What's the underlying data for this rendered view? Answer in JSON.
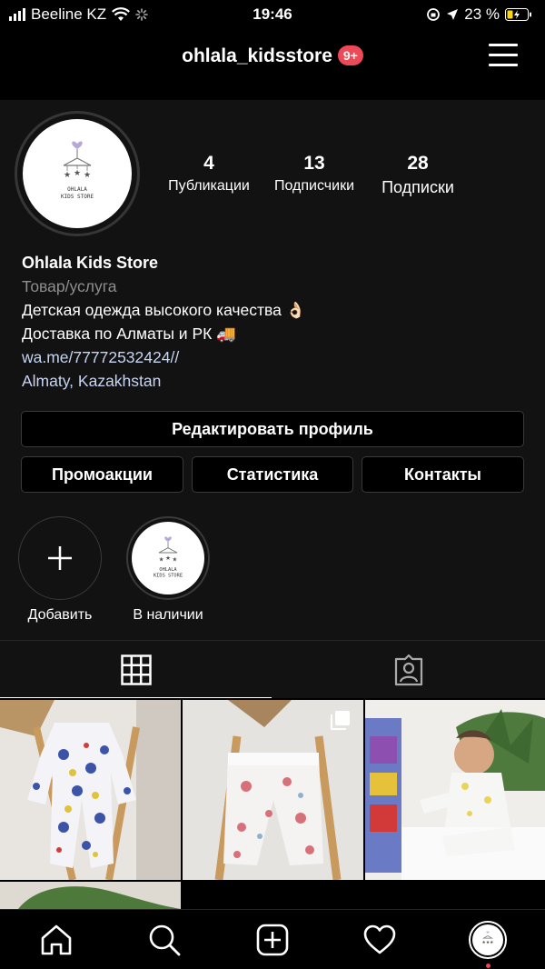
{
  "status_bar": {
    "carrier": "Beeline KZ",
    "time": "19:46",
    "battery": "23 %"
  },
  "header": {
    "username": "ohlala_kidsstore",
    "notification_badge": "9+"
  },
  "profile": {
    "avatar_logo": {
      "line1": "OHLALA",
      "line2": "KIDS STORE"
    },
    "stats": [
      {
        "value": "4",
        "label": "Публикации"
      },
      {
        "value": "13",
        "label": "Подписчики"
      },
      {
        "value": "28",
        "label": "Подписки"
      }
    ],
    "name": "Ohlala Kids Store",
    "category": "Товар/услуга",
    "bio_line1": "Детская одежда высокого качества 👌🏻",
    "bio_line2": "Доставка по Алматы и РК 🚚",
    "link": "wa.me/77772532424//",
    "location": "Almaty, Kazakhstan"
  },
  "buttons": {
    "edit_profile": "Редактировать профиль",
    "promotions": "Промоакции",
    "statistics": "Статистика",
    "contacts": "Контакты"
  },
  "highlights": [
    {
      "label": "Добавить",
      "icon": "plus-icon"
    },
    {
      "label": "В наличии",
      "icon": "store-logo"
    }
  ],
  "tabs": [
    {
      "name": "grid",
      "icon": "grid-icon",
      "active": true
    },
    {
      "name": "tagged",
      "icon": "tagged-person-icon",
      "active": false
    }
  ],
  "bottom_nav": [
    {
      "name": "home",
      "icon": "home-icon"
    },
    {
      "name": "search",
      "icon": "search-icon"
    },
    {
      "name": "new-post",
      "icon": "add-post-icon"
    },
    {
      "name": "activity",
      "icon": "heart-icon"
    },
    {
      "name": "profile",
      "icon": "avatar"
    }
  ],
  "colors": {
    "badge": "#ed4956",
    "link": "#c7d4f2",
    "secondary_text": "#8e8e8e"
  }
}
